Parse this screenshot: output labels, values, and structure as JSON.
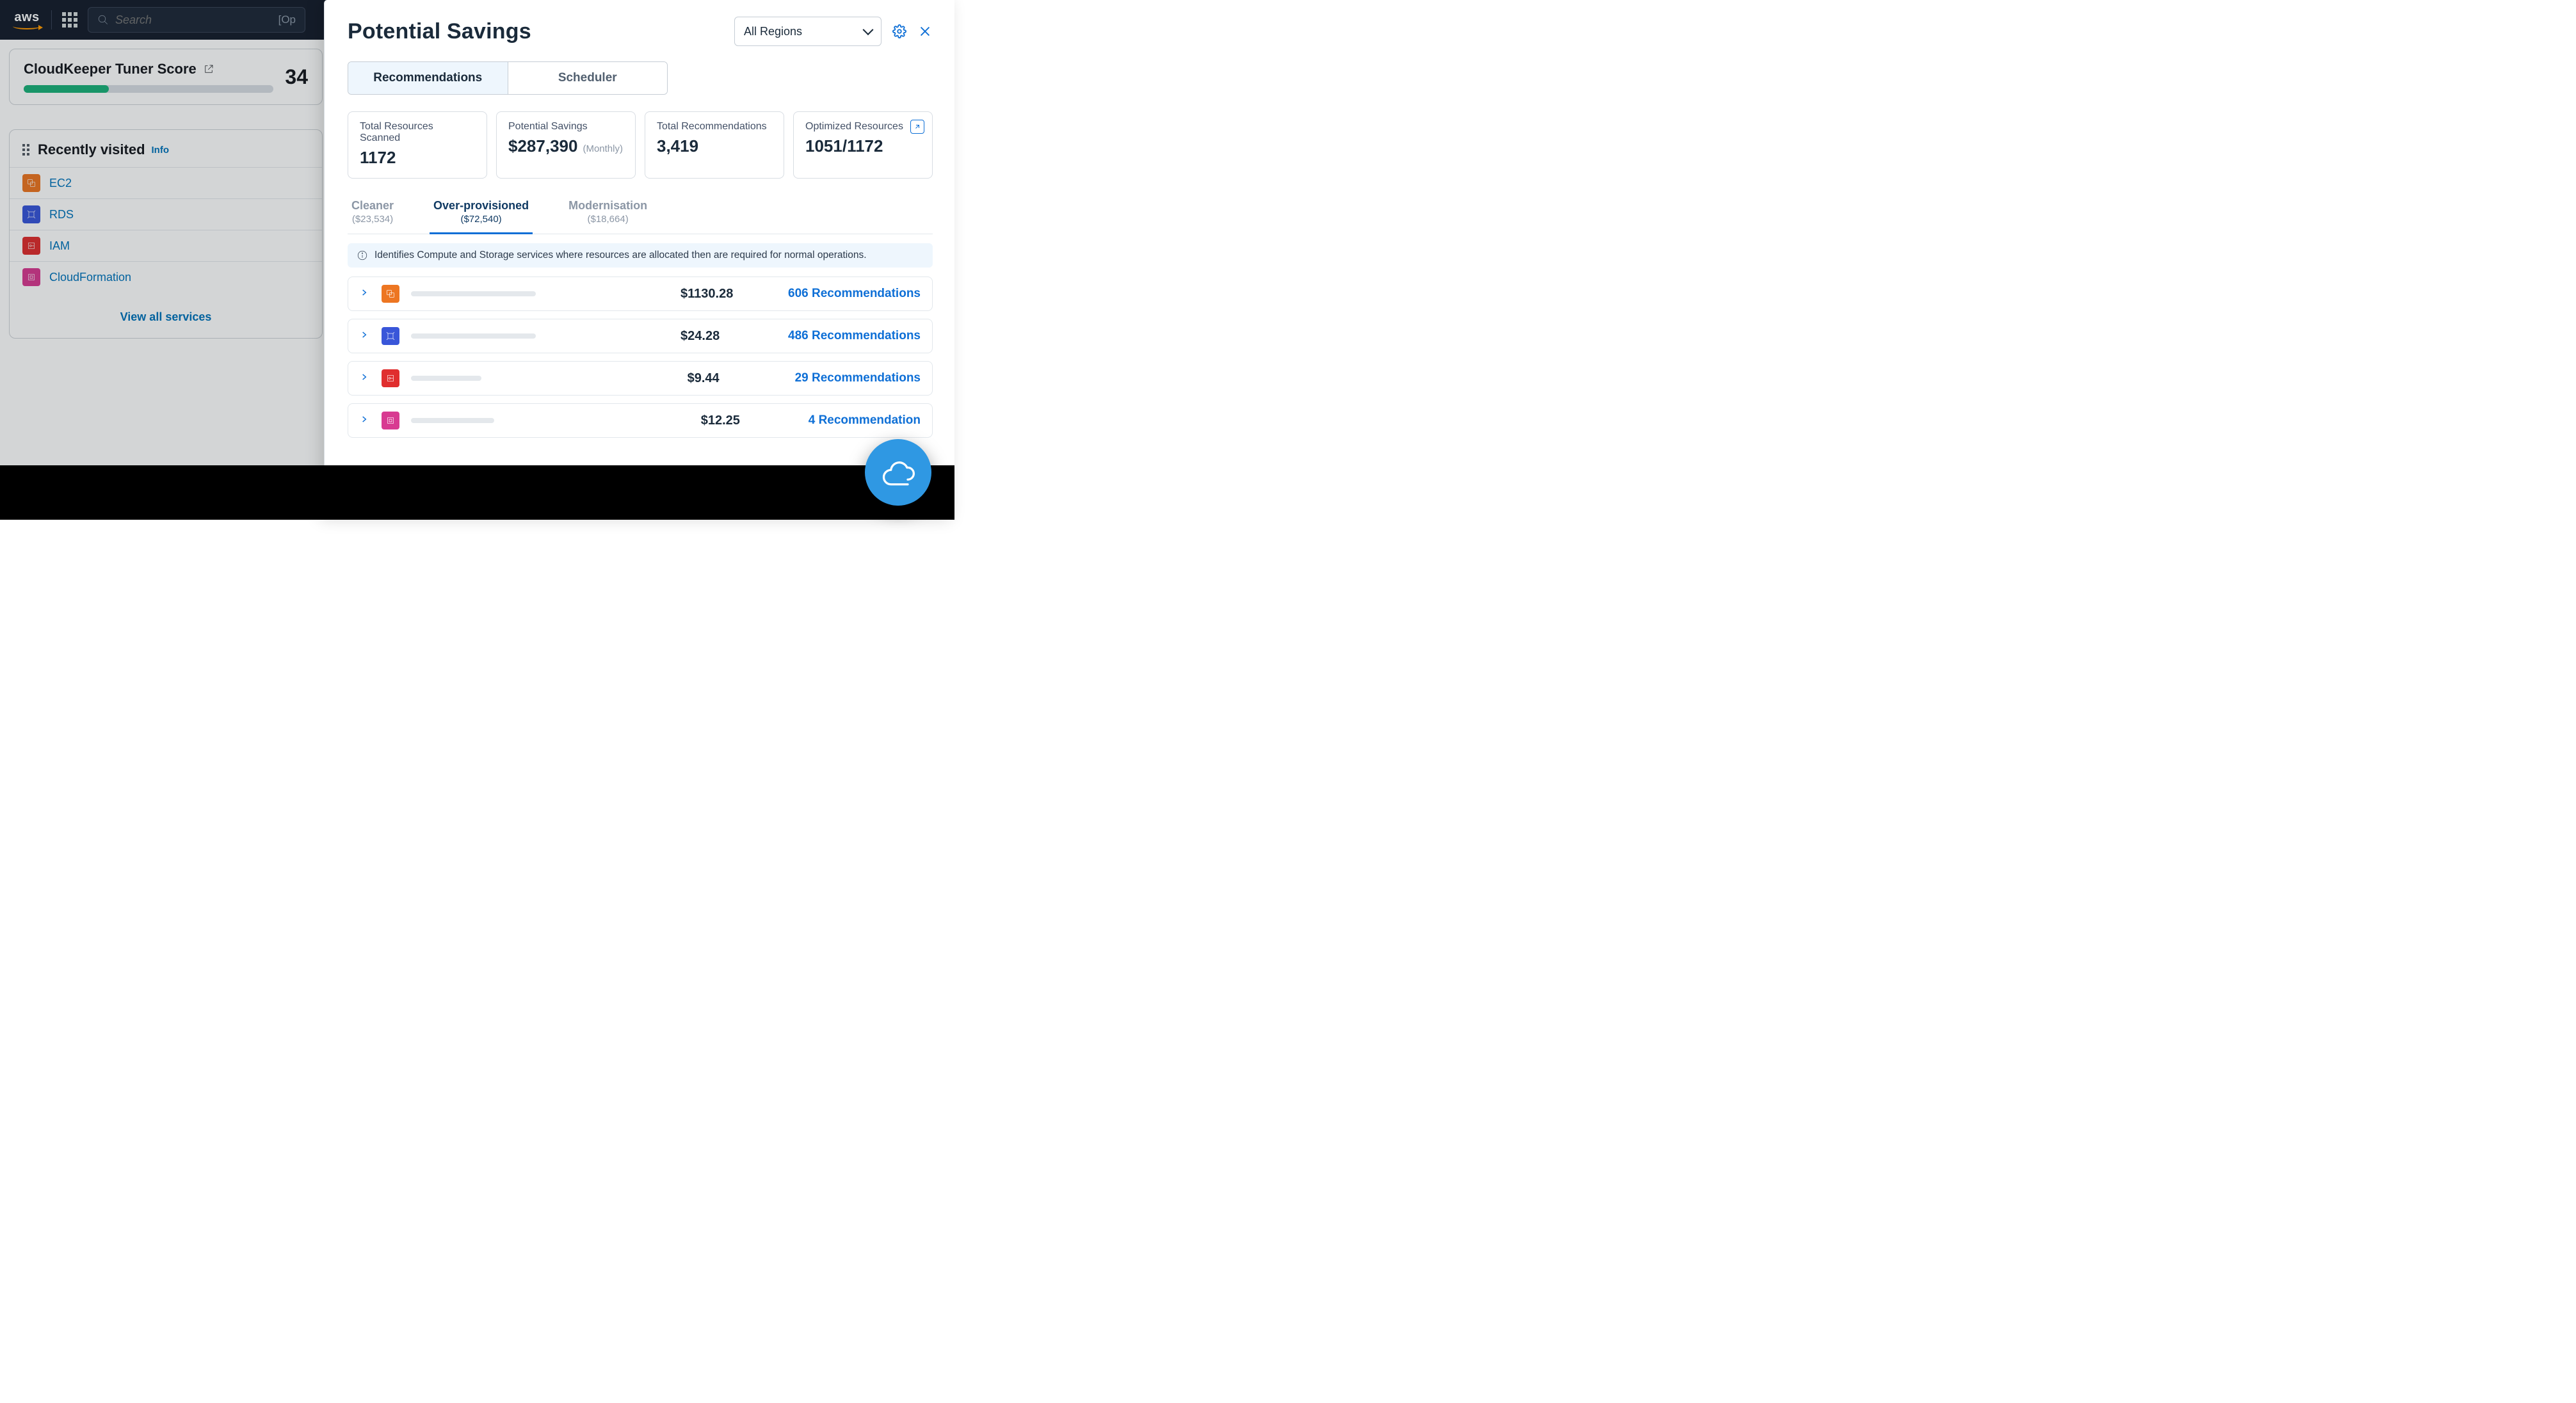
{
  "topnav": {
    "search_placeholder": "Search",
    "search_hint": "[Op"
  },
  "tuner": {
    "title": "CloudKeeper Tuner Score",
    "score": "34"
  },
  "recent": {
    "title": "Recently visited",
    "info": "Info",
    "services": [
      {
        "name": "EC2",
        "icon": "ec2"
      },
      {
        "name": "RDS",
        "icon": "rds"
      },
      {
        "name": "IAM",
        "icon": "iam"
      },
      {
        "name": "CloudFormation",
        "icon": "cf"
      }
    ],
    "view_all": "View all services"
  },
  "panel": {
    "title": "Potential Savings",
    "region": "All Regions",
    "tabs": {
      "recommendations": "Recommendations",
      "scheduler": "Scheduler"
    },
    "stats": [
      {
        "label": "Total Resources Scanned",
        "value": "1172",
        "sub": ""
      },
      {
        "label": "Potential Savings",
        "value": "$287,390",
        "sub": "(Monthly)"
      },
      {
        "label": "Total Recommendations",
        "value": "3,419",
        "sub": ""
      },
      {
        "label": "Optimized Resources",
        "value": "1051/1172",
        "sub": "",
        "link": true
      }
    ],
    "subtabs": [
      {
        "title": "Cleaner",
        "amount": "($23,534)",
        "active": false
      },
      {
        "title": "Over-provisioned",
        "amount": "($72,540)",
        "active": true
      },
      {
        "title": "Modernisation",
        "amount": "($18,664)",
        "active": false
      }
    ],
    "info_text": "Identifies Compute and Storage services where resources are allocated then are required for normal operations.",
    "rows": [
      {
        "icon": "ec2",
        "barw": 195,
        "price": "$1130.28",
        "count": "606 Recommendations"
      },
      {
        "icon": "rds",
        "barw": 195,
        "price": "$24.28",
        "count": "486 Recommendations"
      },
      {
        "icon": "iam",
        "barw": 110,
        "price": "$9.44",
        "count": "29 Recommendations"
      },
      {
        "icon": "cf",
        "barw": 130,
        "price": "$12.25",
        "count": "4 Recommendation"
      }
    ]
  }
}
